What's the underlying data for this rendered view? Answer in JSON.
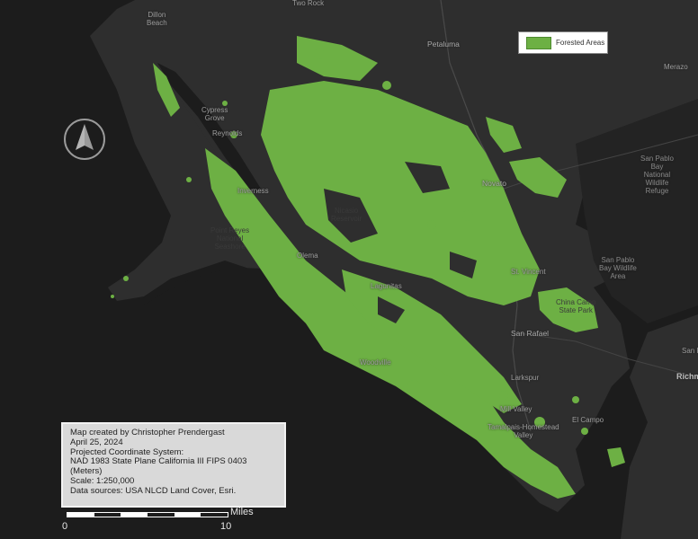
{
  "legend": {
    "label": "Forested Areas",
    "color": "#6db044"
  },
  "north_arrow": {
    "icon": "north-arrow-icon"
  },
  "places": [
    {
      "id": "two-rock",
      "text": "Two Rock"
    },
    {
      "id": "dillon-beach",
      "text": "Dillon\nBeach"
    },
    {
      "id": "petaluma",
      "text": "Petaluma"
    },
    {
      "id": "merazo",
      "text": "Merazo"
    },
    {
      "id": "cypress-grove",
      "text": "Cypress\nGrove"
    },
    {
      "id": "reynolds",
      "text": "Reynolds"
    },
    {
      "id": "novato",
      "text": "Novato"
    },
    {
      "id": "san-pablo-bay-refuge",
      "text": "San Pablo\nBay\nNational\nWildlife\nRefuge"
    },
    {
      "id": "inverness",
      "text": "Inverness"
    },
    {
      "id": "nicasio",
      "text": "Nicasio\nReservoir"
    },
    {
      "id": "point-reyes",
      "text": "Point Reyes\nNational\nSeashore"
    },
    {
      "id": "olema",
      "text": "Olema"
    },
    {
      "id": "san-pablo-bay-area",
      "text": "San Pablo\nBay Wildlife\nArea"
    },
    {
      "id": "st-vincent",
      "text": "St. Vincent"
    },
    {
      "id": "lagunitas",
      "text": "Lagunitas"
    },
    {
      "id": "china-camp",
      "text": "China Camp\nState Park"
    },
    {
      "id": "san-rafael",
      "text": "San Rafael"
    },
    {
      "id": "woodville",
      "text": "Woodville"
    },
    {
      "id": "larkspur",
      "text": "Larkspur"
    },
    {
      "id": "mill-valley",
      "text": "Mill Valley"
    },
    {
      "id": "el-campo",
      "text": "El Campo"
    },
    {
      "id": "tamalpais",
      "text": "Tamalpais-Homestead\nValley"
    },
    {
      "id": "san-p",
      "text": "San P"
    },
    {
      "id": "richm",
      "text": "Richm"
    }
  ],
  "info": {
    "line1": "Map created by Christopher Prendergast",
    "line2": "April 25, 2024",
    "line3": "Projected Coordinate System:",
    "line4": "NAD 1983 State Plane California III FIPS 0403",
    "line5": "(Meters)",
    "line6": "Scale: 1:250,000",
    "line7": "Data sources: USA NLCD Land Cover, Esri."
  },
  "scale": {
    "start": "0",
    "end": "10",
    "unit": "Miles"
  },
  "colors": {
    "forest": "#6db044",
    "land": "#2f2f2f",
    "water": "#1c1c1c"
  }
}
